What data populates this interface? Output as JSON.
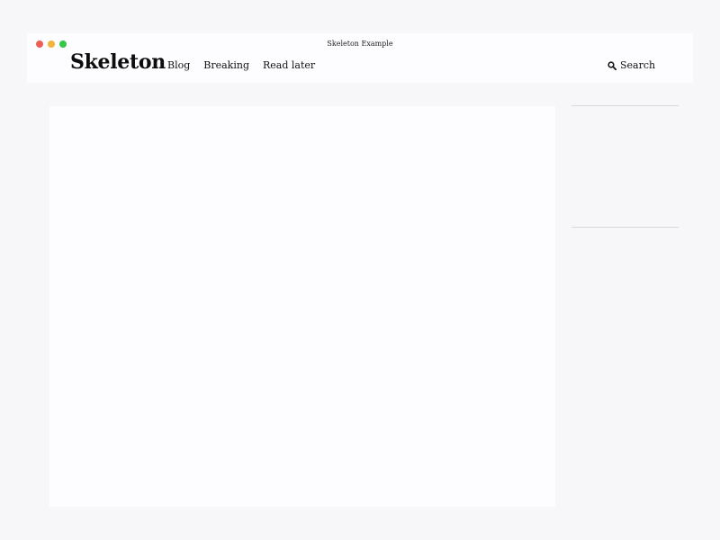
{
  "window": {
    "title": "Skeleton Example",
    "controls": [
      "close",
      "minimize",
      "maximize"
    ]
  },
  "header": {
    "brand": "Skeleton",
    "nav": [
      {
        "label": "Blog"
      },
      {
        "label": "Breaking"
      },
      {
        "label": "Read later"
      }
    ],
    "search": {
      "label": "Search",
      "icon": "search-icon"
    }
  },
  "colors": {
    "page_bg": "#f7f7f9",
    "panel_bg": "#fdfcfe",
    "close": "#ec5f57",
    "minimize": "#f2b43c",
    "maximize": "#34c748",
    "divider": "#d9d8dc"
  }
}
